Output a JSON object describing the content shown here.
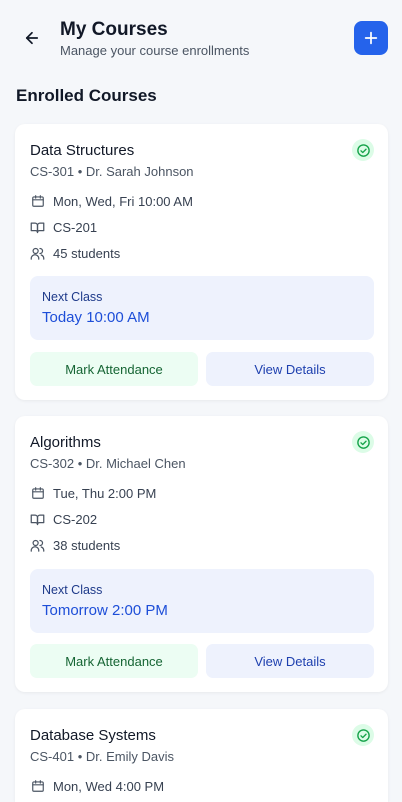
{
  "header": {
    "title": "My Courses",
    "subtitle": "Manage your course enrollments"
  },
  "section_title": "Enrolled Courses",
  "courses": [
    {
      "name": "Data Structures",
      "meta": "CS-301 • Dr. Sarah Johnson",
      "schedule": "Mon, Wed, Fri 10:00 AM",
      "room": "CS-201",
      "students": "45 students",
      "next_label": "Next Class",
      "next_value": "Today 10:00 AM",
      "attend_label": "Mark Attendance",
      "view_label": "View Details"
    },
    {
      "name": "Algorithms",
      "meta": "CS-302 • Dr. Michael Chen",
      "schedule": "Tue, Thu 2:00 PM",
      "room": "CS-202",
      "students": "38 students",
      "next_label": "Next Class",
      "next_value": "Tomorrow 2:00 PM",
      "attend_label": "Mark Attendance",
      "view_label": "View Details"
    },
    {
      "name": "Database Systems",
      "meta": "CS-401 • Dr. Emily Davis",
      "schedule": "Mon, Wed 4:00 PM"
    }
  ],
  "colors": {
    "accent": "#2563eb",
    "success_bg": "#dcfce7",
    "success": "#16a34a",
    "next_bg": "#eef2fd"
  }
}
